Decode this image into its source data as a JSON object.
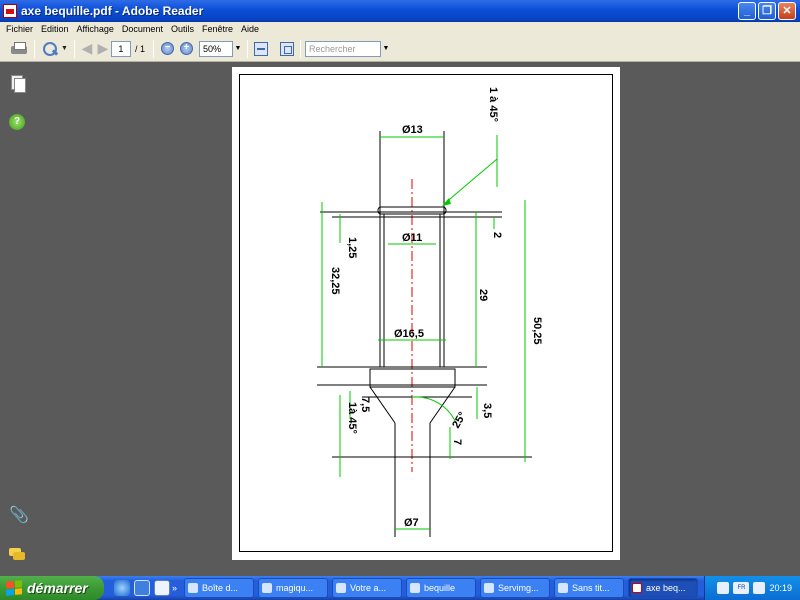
{
  "window": {
    "title": "axe bequille.pdf - Adobe Reader",
    "minimize": "_",
    "restore": "❐",
    "close": "✕"
  },
  "menu": [
    "Fichier",
    "Edition",
    "Affichage",
    "Document",
    "Outils",
    "Fenêtre",
    "Aide"
  ],
  "toolbar": {
    "page_current": "1",
    "page_total": "/ 1",
    "zoom_value": "50%",
    "search_placeholder": "Rechercher"
  },
  "nav_icons": [
    "pages-icon",
    "help-icon",
    "attachment-icon",
    "comments-icon"
  ],
  "drawing": {
    "labels": {
      "d13": "Ø13",
      "chamfer_top": "1 à 45°",
      "d11": "Ø11",
      "dim_2": "2",
      "dim_1_25": "1,25",
      "dim_32_25": "32,25",
      "dim_29": "29",
      "dim_50_25": "50,25",
      "d16_5": "Ø16,5",
      "dim_7_5": "7,5",
      "chamfer_bottom": "1à 45°",
      "angle_25": "25°",
      "dim_3_5": "3,5",
      "dim_7": "7",
      "d7": "Ø7"
    },
    "colors": {
      "dimension": "#00c800",
      "axis": "#e00000",
      "outline": "#000000"
    }
  },
  "taskbar": {
    "start_label": "démarrer",
    "tasks": [
      {
        "label": "Boîte d...",
        "icon": "folder-icon",
        "active": false
      },
      {
        "label": "magiqu...",
        "icon": "ie-icon",
        "active": false
      },
      {
        "label": "Votre a...",
        "icon": "messenger-icon",
        "active": false
      },
      {
        "label": "bequille",
        "icon": "folder-icon",
        "active": false
      },
      {
        "label": "Servimg...",
        "icon": "ie-icon",
        "active": false
      },
      {
        "label": "Sans tit...",
        "icon": "paint-icon",
        "active": false
      },
      {
        "label": "axe beq...",
        "icon": "adobe-icon",
        "active": true
      }
    ],
    "clock": "20:19",
    "tray_badge": "FR"
  }
}
